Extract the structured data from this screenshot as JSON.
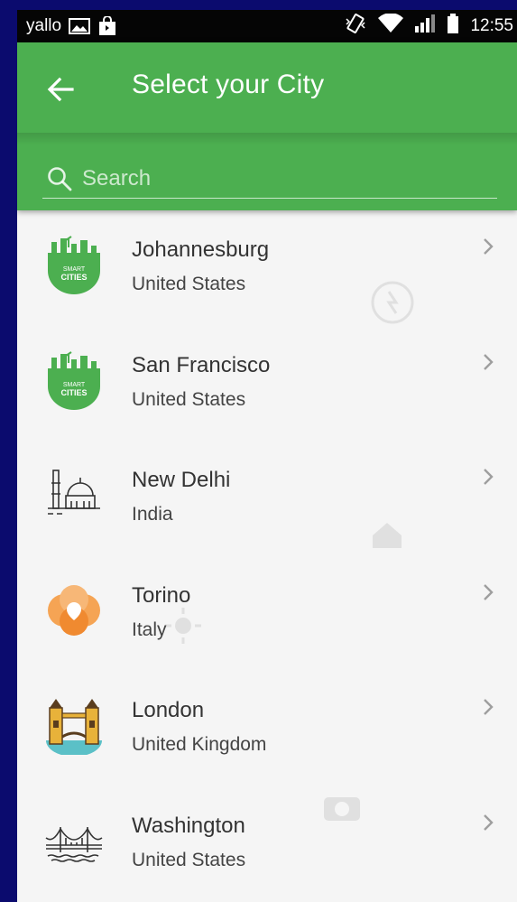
{
  "status_bar": {
    "carrier": "yallo",
    "time": "12:55",
    "icons": [
      "image-icon",
      "shopping-bag-icon",
      "vibrate-icon",
      "wifi-icon",
      "signal-icon",
      "battery-icon"
    ]
  },
  "header": {
    "title": "Select your City",
    "back_icon": "arrow-left-icon",
    "search": {
      "placeholder": "Search",
      "value": ""
    }
  },
  "colors": {
    "primary": "#4caf50",
    "status_bar": "#050505",
    "frame": "#0b0b6e",
    "list_bg": "#f5f5f5"
  },
  "cities": [
    {
      "name": "Johannesburg",
      "country": "United States",
      "logo": "smart-cities-logo"
    },
    {
      "name": "San Francisco",
      "country": "United States",
      "logo": "smart-cities-logo"
    },
    {
      "name": "New Delhi",
      "country": "India",
      "logo": "monument-logo"
    },
    {
      "name": "Torino",
      "country": "Italy",
      "logo": "orange-flower-logo"
    },
    {
      "name": "London",
      "country": "United Kingdom",
      "logo": "tower-bridge-logo"
    },
    {
      "name": "Washington",
      "country": "United States",
      "logo": "suspension-bridge-logo"
    }
  ]
}
